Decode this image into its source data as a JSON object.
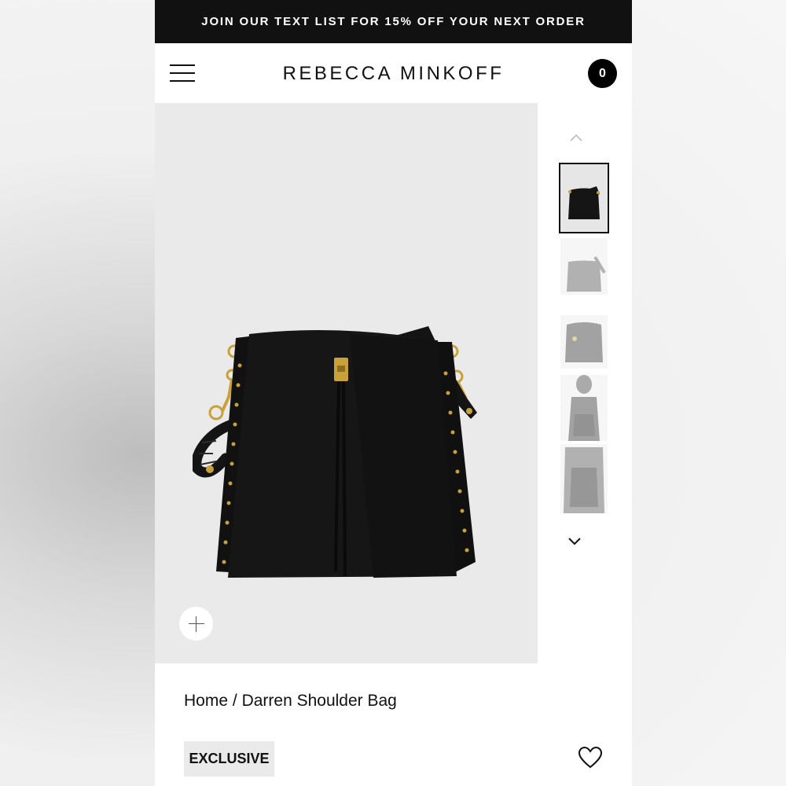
{
  "promo": {
    "text": "JOIN OUR TEXT LIST FOR 15% OFF YOUR NEXT ORDER"
  },
  "header": {
    "brand": "REBECCA MINKOFF",
    "cart_count": "0"
  },
  "breadcrumb": {
    "home": "Home",
    "separator": "/",
    "current": "Darren Shoulder Bag"
  },
  "product": {
    "badge": "EXCLUSIVE"
  },
  "colors": {
    "promo_bg": "#111111",
    "hero_bg": "#eaeaea",
    "badge_bg": "#eaeaea",
    "hardware_gold": "#c9a13b"
  }
}
